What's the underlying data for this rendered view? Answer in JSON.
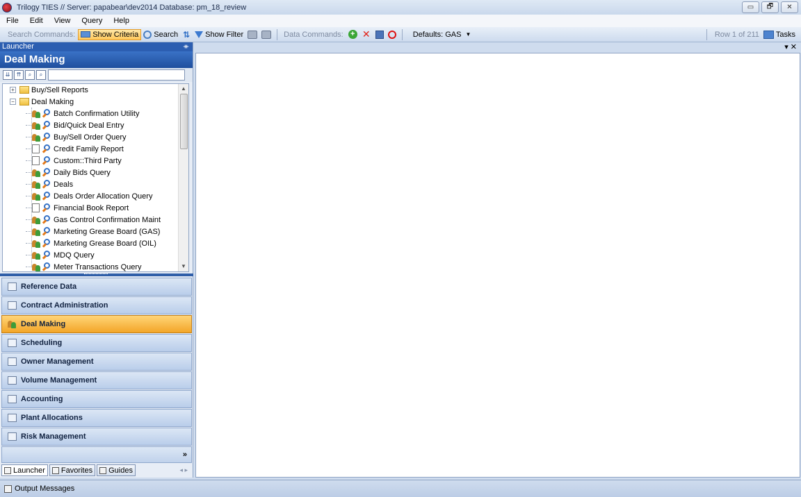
{
  "window": {
    "title": "Trilogy TIES //  Server: papabear\\dev2014 Database: pm_18_review",
    "controls": [
      "▭",
      "🗗",
      "✕"
    ]
  },
  "menu": [
    "File",
    "Edit",
    "View",
    "Query",
    "Help"
  ],
  "toolbar": {
    "search_commands_label": "Search Commands:",
    "show_criteria": "Show Criteria",
    "search": "Search",
    "show_filter": "Show Filter",
    "data_commands_label": "Data Commands:",
    "defaults": "Defaults: GAS",
    "row_count": "Row 1 of 211",
    "tasks": "Tasks"
  },
  "launcher": {
    "header": "Launcher",
    "pin_glyph": "ᚑ",
    "title": "Deal Making",
    "search_buttons": [
      "⇊",
      "⇈",
      "⌕",
      "⌕"
    ],
    "search_value": ""
  },
  "tree": {
    "folders": [
      {
        "label": "Buy/Sell Reports",
        "expander": "+"
      },
      {
        "label": "Deal Making",
        "expander": "−"
      }
    ],
    "items": [
      {
        "label": "Batch Confirmation Utility",
        "kind": "people"
      },
      {
        "label": "Bid/Quick Deal Entry",
        "kind": "people"
      },
      {
        "label": "Buy/Sell Order Query",
        "kind": "people"
      },
      {
        "label": "Credit Family Report",
        "kind": "doc"
      },
      {
        "label": "Custom::Third Party",
        "kind": "doc"
      },
      {
        "label": "Daily Bids Query",
        "kind": "people"
      },
      {
        "label": "Deals",
        "kind": "people"
      },
      {
        "label": "Deals Order Allocation Query",
        "kind": "people"
      },
      {
        "label": "Financial Book Report",
        "kind": "doc"
      },
      {
        "label": "Gas Control Confirmation Maint",
        "kind": "people"
      },
      {
        "label": "Marketing Grease Board (GAS)",
        "kind": "people"
      },
      {
        "label": "Marketing Grease Board (OIL)",
        "kind": "people"
      },
      {
        "label": "MDQ Query",
        "kind": "people"
      },
      {
        "label": "Meter Transactions Query",
        "kind": "people"
      }
    ]
  },
  "nav": [
    {
      "label": "Reference Data",
      "icon": "reference-icon",
      "active": false
    },
    {
      "label": "Contract Administration",
      "icon": "contract-icon",
      "active": false
    },
    {
      "label": "Deal Making",
      "icon": "people-icon",
      "active": true
    },
    {
      "label": "Scheduling",
      "icon": "scheduling-icon",
      "active": false
    },
    {
      "label": "Owner Management",
      "icon": "owner-icon",
      "active": false
    },
    {
      "label": "Volume Management",
      "icon": "volume-icon",
      "active": false
    },
    {
      "label": "Accounting",
      "icon": "accounting-icon",
      "active": false
    },
    {
      "label": "Plant Allocations",
      "icon": "plant-icon",
      "active": false
    },
    {
      "label": "Risk Management",
      "icon": "risk-icon",
      "active": false
    }
  ],
  "nav_overflow_glyph": "»",
  "bottom_tabs": [
    {
      "label": "Launcher",
      "active": true
    },
    {
      "label": "Favorites",
      "active": false
    },
    {
      "label": "Guides",
      "active": false
    }
  ],
  "bottom_tab_arrows": "◂ ▸",
  "doc_controls": "▾ ✕",
  "status": {
    "output_messages": "Output Messages"
  }
}
